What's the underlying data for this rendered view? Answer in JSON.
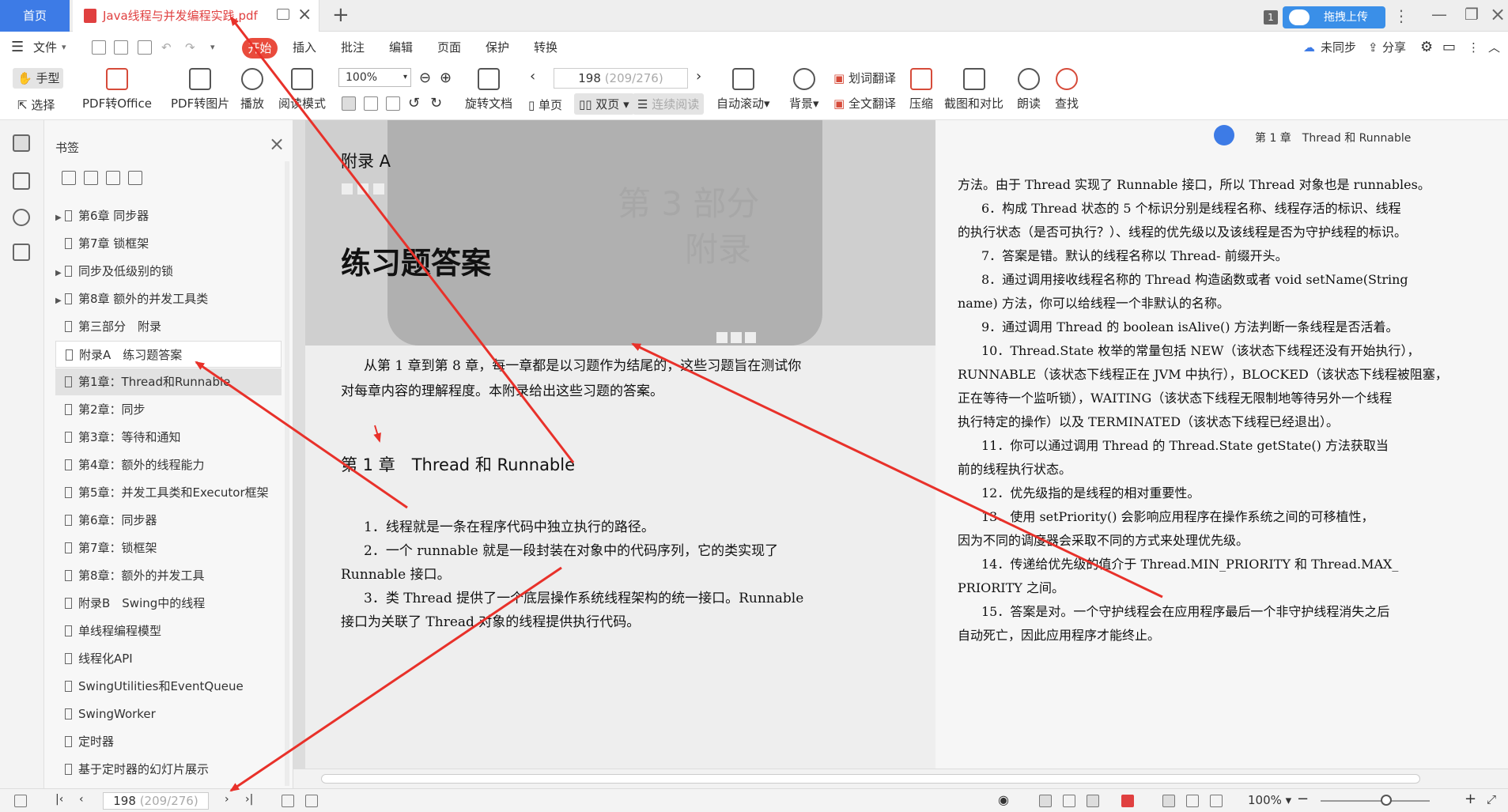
{
  "tabs": {
    "home": "首页",
    "document_title": "Java线程与并发编程实践.pdf",
    "new_tab": "+",
    "tab_count": "1",
    "upload_button": "拖拽上传"
  },
  "menu": {
    "file": "文件",
    "start": "开始",
    "insert": "插入",
    "annotate": "批注",
    "edit": "编辑",
    "page": "页面",
    "protect": "保护",
    "convert": "转换",
    "unsynced": "未同步",
    "share": "分享"
  },
  "toolbar": {
    "hand_tool": "手型",
    "select_tool": "选择",
    "pdf_to_office": "PDF转Office",
    "pdf_to_image": "PDF转图片",
    "play": "播放",
    "read_mode": "阅读模式",
    "zoom_value": "100%",
    "rotate_doc": "旋转文档",
    "page_number": "198",
    "page_of_total": "(209/276)",
    "single_page": "单页",
    "double_page": "双页",
    "continuous": "连续阅读",
    "auto_scroll": "自动滚动",
    "background": "背景",
    "word_translate": "划词翻译",
    "full_translate": "全文翻译",
    "compress": "压缩",
    "screenshot_compare": "截图和对比",
    "read_aloud": "朗读",
    "find": "查找"
  },
  "bookmarks": {
    "title": "书签",
    "items": [
      {
        "label": "第6章 同步器",
        "expandable": true
      },
      {
        "label": "第7章 锁框架",
        "expandable": false
      },
      {
        "label": "同步及低级别的锁",
        "expandable": true
      },
      {
        "label": "第8章 额外的并发工具类",
        "expandable": true
      },
      {
        "label": "第三部分　附录",
        "expandable": false
      },
      {
        "label": "附录A　练习题答案",
        "expandable": false
      },
      {
        "label": "第1章：Thread和Runnable",
        "expandable": false
      },
      {
        "label": "第2章：同步",
        "expandable": false
      },
      {
        "label": "第3章：等待和通知",
        "expandable": false
      },
      {
        "label": "第4章：额外的线程能力",
        "expandable": false
      },
      {
        "label": "第5章：并发工具类和Executor框架",
        "expandable": false
      },
      {
        "label": "第6章：同步器",
        "expandable": false
      },
      {
        "label": "第7章：锁框架",
        "expandable": false
      },
      {
        "label": "第8章：额外的并发工具",
        "expandable": false
      },
      {
        "label": "附录B　Swing中的线程",
        "expandable": false
      },
      {
        "label": "单线程编程模型",
        "expandable": false
      },
      {
        "label": "线程化API",
        "expandable": false
      },
      {
        "label": "SwingUtilities和EventQueue",
        "expandable": false
      },
      {
        "label": "SwingWorker",
        "expandable": false
      },
      {
        "label": "定时器",
        "expandable": false
      },
      {
        "label": "基于定时器的幻灯片展示",
        "expandable": false
      }
    ]
  },
  "left_page": {
    "appendix": "附录 A",
    "part_watermark_1": "第 3 部分",
    "part_watermark_2": "附录",
    "heading": "练习题答案",
    "intro_1": "从第 1 章到第 8 章，每一章都是以习题作为结尾的，这些习题旨在测试你",
    "intro_2": "对每章内容的理解程度。本附录给出这些习题的答案。",
    "chapter_heading": "第 1 章　Thread 和 Runnable",
    "lines": [
      "1．线程就是一条在程序代码中独立执行的路径。",
      "2．一个 runnable 就是一段封装在对象中的代码序列，它的类实现了",
      "Runnable 接口。",
      "3．类 Thread 提供了一个底层操作系统线程架构的统一接口。Runnable",
      "接口为关联了 Thread 对象的线程提供执行代码。"
    ]
  },
  "right_page": {
    "header": "第 1 章　Thread 和 Runnable",
    "lines": [
      "方法。由于 Thread 实现了 Runnable 接口，所以 Thread 对象也是 runnables。",
      "6．构成 Thread 状态的 5 个标识分别是线程名称、线程存活的标识、线程",
      "的执行状态（是否可执行？）、线程的优先级以及该线程是否为守护线程的标识。",
      "7．答案是错。默认的线程名称以 Thread- 前缀开头。",
      "8．通过调用接收线程名称的 Thread 构造函数或者 void setName(String",
      "name) 方法，你可以给线程一个非默认的名称。",
      "9．通过调用 Thread 的 boolean isAlive() 方法判断一条线程是否活着。",
      "10．Thread.State 枚举的常量包括 NEW（该状态下线程还没有开始执行），",
      "RUNNABLE（该状态下线程正在 JVM 中执行），BLOCKED（该状态下线程被阻塞，",
      "正在等待一个监听锁），WAITING（该状态下线程无限制地等待另外一个线程",
      "执行特定的操作）以及 TERMINATED（该状态下线程已经退出）。",
      "11．你可以通过调用 Thread 的 Thread.State getState() 方法获取当",
      "前的线程执行状态。",
      "12．优先级指的是线程的相对重要性。",
      "13．使用 setPriority() 会影响应用程序在操作系统之间的可移植性，",
      "因为不同的调度器会采取不同的方式来处理优先级。",
      "14．传递给优先级的值介于 Thread.MIN_PRIORITY 和 Thread.MAX_",
      "PRIORITY 之间。",
      "15．答案是对。一个守护线程会在应用程序最后一个非守护线程消失之后",
      "自动死亡，因此应用程序才能终止。"
    ]
  },
  "statusbar": {
    "page_number": "198",
    "page_of_total": "(209/276)",
    "zoom": "100%"
  },
  "colors": {
    "accent_blue": "#3d7be6",
    "start_red": "#e94b3c",
    "arrow_red": "#e8312a"
  }
}
